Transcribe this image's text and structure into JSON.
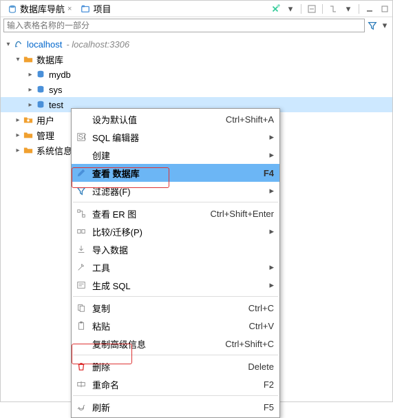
{
  "tabs": {
    "nav": "数据库导航",
    "proj": "项目"
  },
  "search": {
    "placeholder": "输入表格名称的一部分"
  },
  "tree": {
    "conn": {
      "name": "localhost",
      "extra": "- localhost:3306"
    },
    "dbfolder": "数据库",
    "dbs": [
      "mydb",
      "sys",
      "test"
    ],
    "users": "用户",
    "admin": "管理",
    "sysinfo": "系统信息"
  },
  "menu": {
    "set_default": {
      "label": "设为默认值",
      "shortcut": "Ctrl+Shift+A"
    },
    "sql_editor": {
      "label": "SQL 编辑器"
    },
    "create": {
      "label": "创建"
    },
    "view_db": {
      "label": "查看 数据库",
      "shortcut": "F4"
    },
    "filter": {
      "label": "过滤器(F)"
    },
    "er": {
      "label": "查看 ER 图",
      "shortcut": "Ctrl+Shift+Enter"
    },
    "compare": {
      "label": "比较/迁移(P)"
    },
    "import": {
      "label": "导入数据"
    },
    "tools": {
      "label": "工具"
    },
    "gensql": {
      "label": "生成 SQL"
    },
    "copy": {
      "label": "复制",
      "shortcut": "Ctrl+C"
    },
    "paste": {
      "label": "粘贴",
      "shortcut": "Ctrl+V"
    },
    "copyadv": {
      "label": "复制高级信息",
      "shortcut": "Ctrl+Shift+C"
    },
    "delete": {
      "label": "删除",
      "shortcut": "Delete"
    },
    "rename": {
      "label": "重命名",
      "shortcut": "F2"
    },
    "refresh": {
      "label": "刷新",
      "shortcut": "F5"
    }
  }
}
